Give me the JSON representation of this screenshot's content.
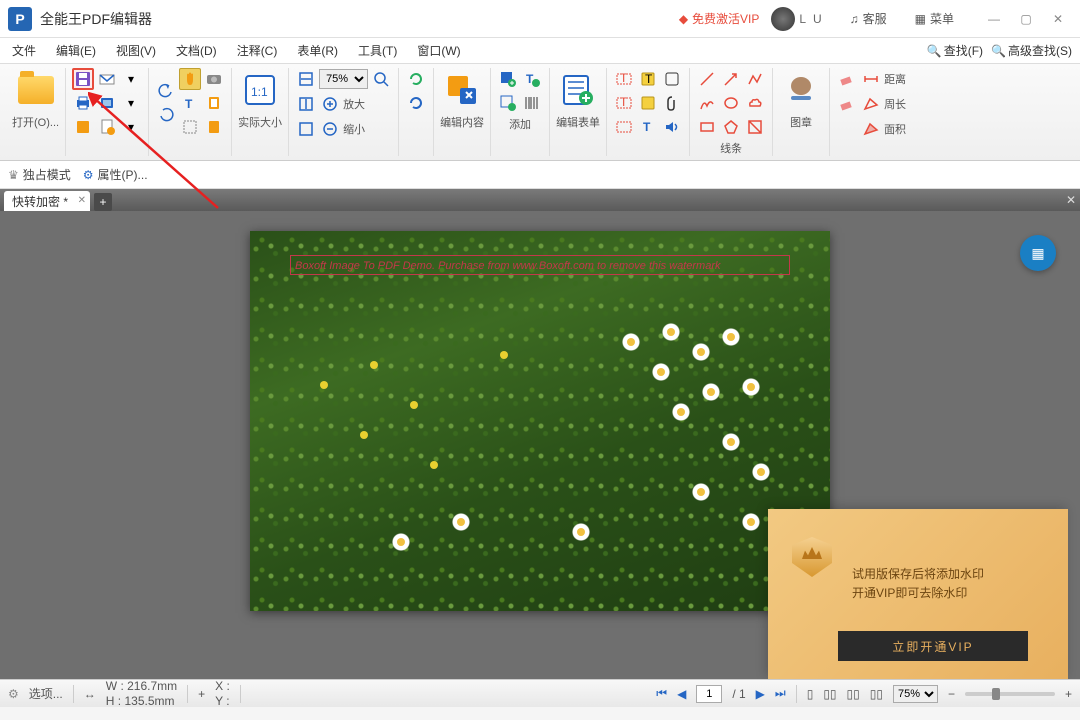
{
  "app": {
    "title": "全能王PDF编辑器"
  },
  "titlebar": {
    "vip_link": "免费激活VIP",
    "user_name": "L U",
    "support": "客服",
    "menu": "菜单"
  },
  "menubar": {
    "file": "文件",
    "edit": "编辑(E)",
    "view": "视图(V)",
    "document": "文档(D)",
    "comment": "注释(C)",
    "form": "表单(R)",
    "tool": "工具(T)",
    "window": "窗口(W)",
    "find": "查找(F)",
    "adv_find": "高级查找(S)"
  },
  "toolbar": {
    "open": "打开(O)...",
    "actual_size": "实际大小",
    "zoom_value": "75%",
    "zoom_in": "放大",
    "zoom_out": "缩小",
    "edit_content": "编辑内容",
    "add": "添加",
    "edit_form": "编辑表单",
    "lines": "线条",
    "stamp": "图章",
    "distance": "距离",
    "perimeter": "周长",
    "area": "面积"
  },
  "subbar": {
    "exclusive_mode": "独占模式",
    "properties": "属性(P)..."
  },
  "tabs": {
    "doc_name": "快转加密 *"
  },
  "page": {
    "watermark": "Boxoft Image To PDF Demo. Purchase from www.Boxoft.com to remove this watermark"
  },
  "vip_popup": {
    "line1": "试用版保存后将添加水印",
    "line2": "开通VIP即可去除水印",
    "button": "立即开通VIP"
  },
  "statusbar": {
    "options": "选项...",
    "width_label": "W :",
    "width_value": "216.7mm",
    "height_label": "H :",
    "height_value": "135.5mm",
    "x_label": "X :",
    "y_label": "Y :",
    "page_current": "1",
    "page_total": "/ 1",
    "zoom": "75%"
  }
}
